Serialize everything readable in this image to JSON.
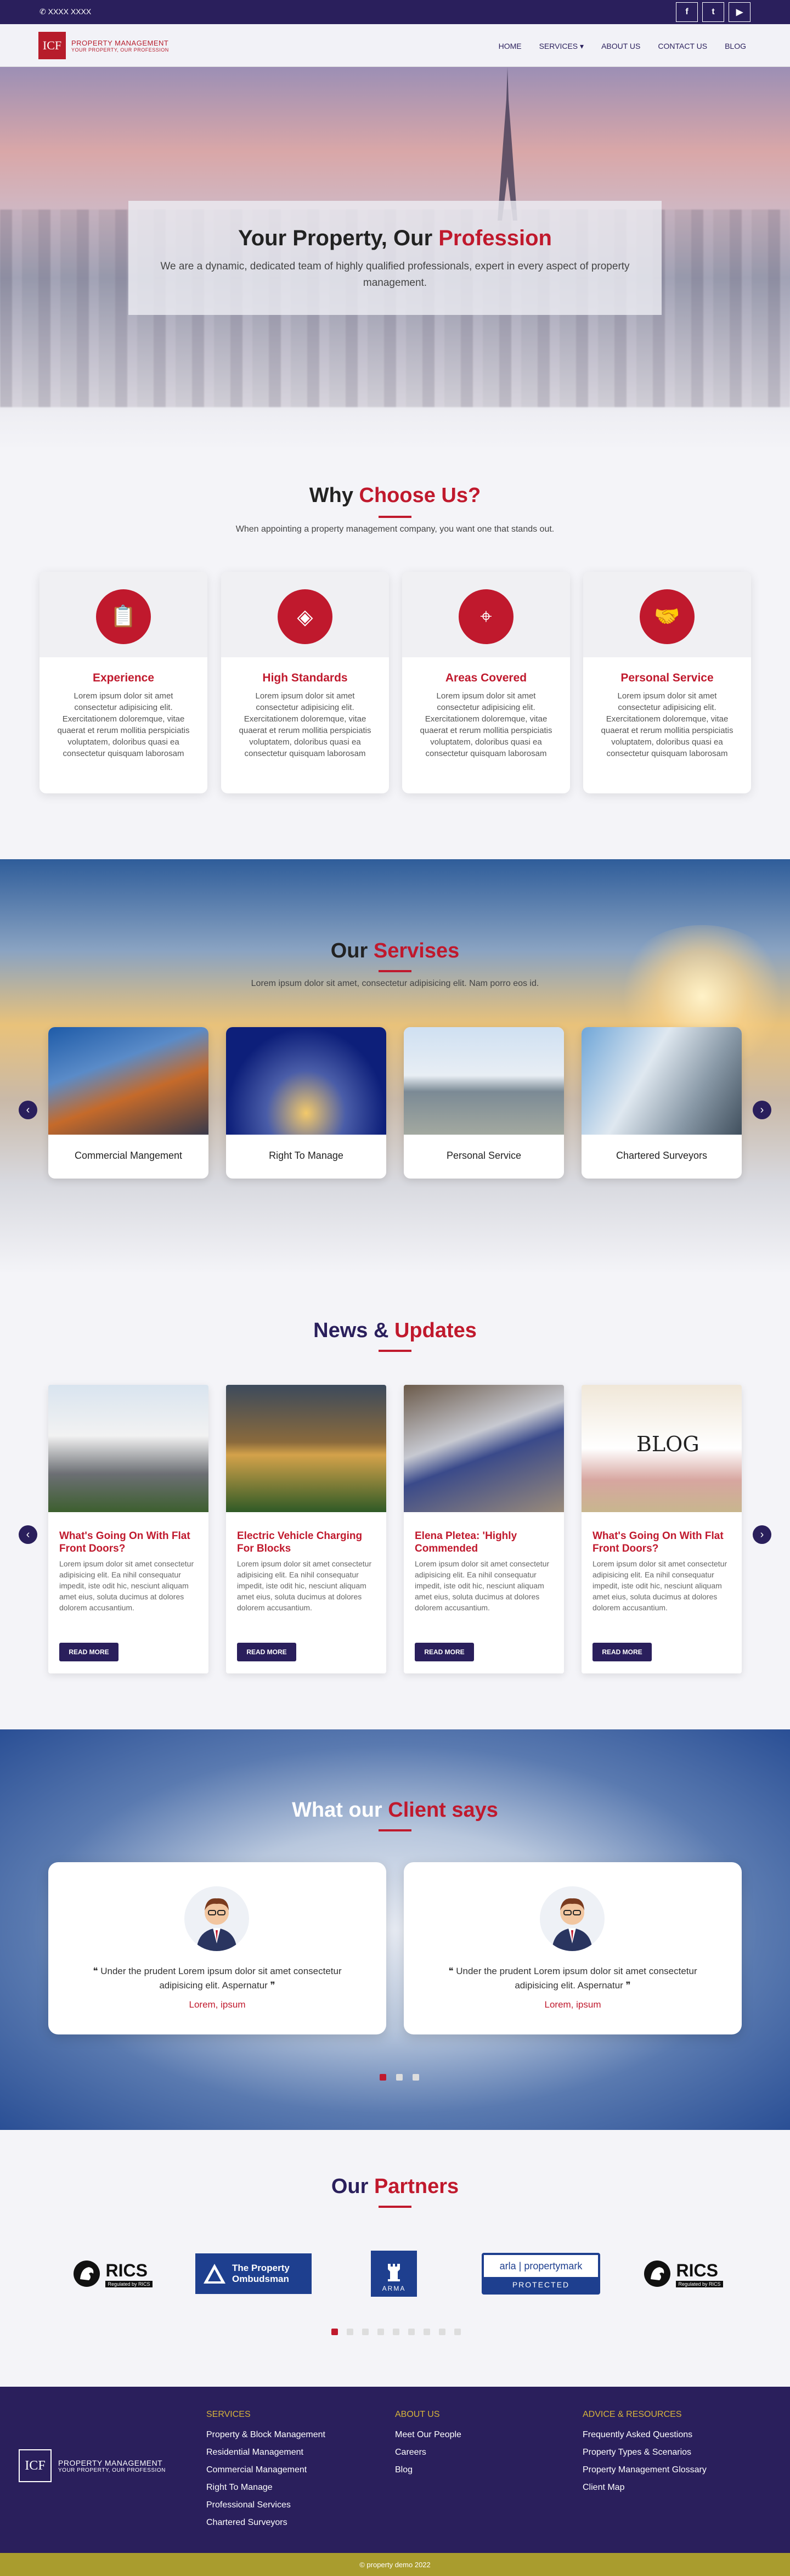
{
  "topbar": {
    "phone": "XXXX XXXX",
    "social": [
      "f",
      "t",
      "▶"
    ]
  },
  "brand": {
    "logo_text": "ICF",
    "name": "PROPERTY MANAGEMENT",
    "tagline": "YOUR PROPERTY, OUR PROFESSION"
  },
  "nav": {
    "items": [
      "HOME",
      "SERVICES",
      "ABOUT US",
      "CONTACT US",
      "BLOG"
    ]
  },
  "hero": {
    "title_a": "Your Property, Our ",
    "title_b": "Profession",
    "text": "We are a dynamic, dedicated team of highly qualified professionals, expert in every aspect of property management."
  },
  "why": {
    "title_a": "Why ",
    "title_b": "Choose Us?",
    "subtitle": "When appointing a property management company, you want one that stands out.",
    "cards": [
      {
        "icon": "clipboard-icon",
        "title": "Experience",
        "text": "Lorem ipsum dolor sit amet consectetur adipisicing elit. Exercitationem doloremque, vitae quaerat et rerum mollitia perspiciatis voluptatem, doloribus quasi ea consectetur quisquam laborosam"
      },
      {
        "icon": "diamond-icon",
        "title": "High Standards",
        "text": "Lorem ipsum dolor sit amet consectetur adipisicing elit. Exercitationem doloremque, vitae quaerat et rerum mollitia perspiciatis voluptatem, doloribus quasi ea consectetur quisquam laborosam"
      },
      {
        "icon": "location-pin-icon",
        "title": "Areas Covered",
        "text": "Lorem ipsum dolor sit amet consectetur adipisicing elit. Exercitationem doloremque, vitae quaerat et rerum mollitia perspiciatis voluptatem, doloribus quasi ea consectetur quisquam laborosam"
      },
      {
        "icon": "handshake-icon",
        "title": "Personal Service",
        "text": "Lorem ipsum dolor sit amet consectetur adipisicing elit. Exercitationem doloremque, vitae quaerat et rerum mollitia perspiciatis voluptatem, doloribus quasi ea consectetur quisquam laborosam"
      }
    ]
  },
  "services": {
    "title_a": "Our ",
    "title_b": "Servises",
    "subtitle": "Lorem ipsum dolor sit amet, consectetur adipisicing elit. Nam porro eos id.",
    "items": [
      "Commercial Mangement",
      "Right To Manage",
      "Personal Service",
      "Chartered Surveyors"
    ]
  },
  "news": {
    "title_a": "News & ",
    "title_b": "Updates",
    "button": "READ MORE",
    "items": [
      {
        "title": "What's Going On With Flat Front Doors?",
        "text": "Lorem ipsum dolor sit amet consectetur adipisicing elit. Ea nihil consequatur impedit, iste odit hic, nesciunt aliquam amet eius, soluta ducimus at dolores dolorem accusantium."
      },
      {
        "title": "Electric Vehicle Charging For Blocks",
        "text": "Lorem ipsum dolor sit amet consectetur adipisicing elit. Ea nihil consequatur impedit, iste odit hic, nesciunt aliquam amet eius, soluta ducimus at dolores dolorem accusantium."
      },
      {
        "title": "Elena Pletea: 'Highly Commended",
        "text": "Lorem ipsum dolor sit amet consectetur adipisicing elit. Ea nihil consequatur impedit, iste odit hic, nesciunt aliquam amet eius, soluta ducimus at dolores dolorem accusantium."
      },
      {
        "title": "What's Going On With Flat Front Doors?",
        "text": "Lorem ipsum dolor sit amet consectetur adipisicing elit. Ea nihil consequatur impedit, iste odit hic, nesciunt aliquam amet eius, soluta ducimus at dolores dolorem accusantium."
      }
    ]
  },
  "clients": {
    "title_a": "What our ",
    "title_b": "Client says",
    "items": [
      {
        "quote": "❝ Under the prudent Lorem ipsum dolor sit amet consectetur adipisicing elit. Aspernatur ❞",
        "name": "Lorem, ipsum"
      },
      {
        "quote": "❝ Under the prudent Lorem ipsum dolor sit amet consectetur adipisicing elit. Aspernatur ❞",
        "name": "Lorem, ipsum"
      }
    ]
  },
  "partners": {
    "title_a": "Our ",
    "title_b": "Partners",
    "logos": [
      {
        "a": "RICS",
        "b": "Regulated by RICS"
      },
      {
        "a": "The Property",
        "b": "Ombudsman"
      },
      {
        "a": "ARMA",
        "b": ""
      },
      {
        "a": "arla | propertymark",
        "b": "PROTECTED"
      },
      {
        "a": "RICS",
        "b": "Regulated by RICS"
      }
    ]
  },
  "footer": {
    "services": {
      "heading": "SERVICES",
      "links": [
        "Property & Block Management",
        "Residential Management",
        "Commercial Management",
        "Right To Manage",
        "Professional Services",
        "Chartered Surveyors"
      ]
    },
    "about": {
      "heading": "ABOUT US",
      "links": [
        "Meet Our People",
        "Careers",
        "Blog"
      ]
    },
    "advice": {
      "heading": "ADVICE & RESOURCES",
      "links": [
        "Frequently Asked Questions",
        "Property Types & Scenarios",
        "Property Management Glossary",
        "Client Map"
      ]
    },
    "copyright": "© property demo 2022"
  },
  "colors": {
    "primary": "#2a1f5c",
    "accent": "#c0192d",
    "gold": "#d7b43a"
  }
}
